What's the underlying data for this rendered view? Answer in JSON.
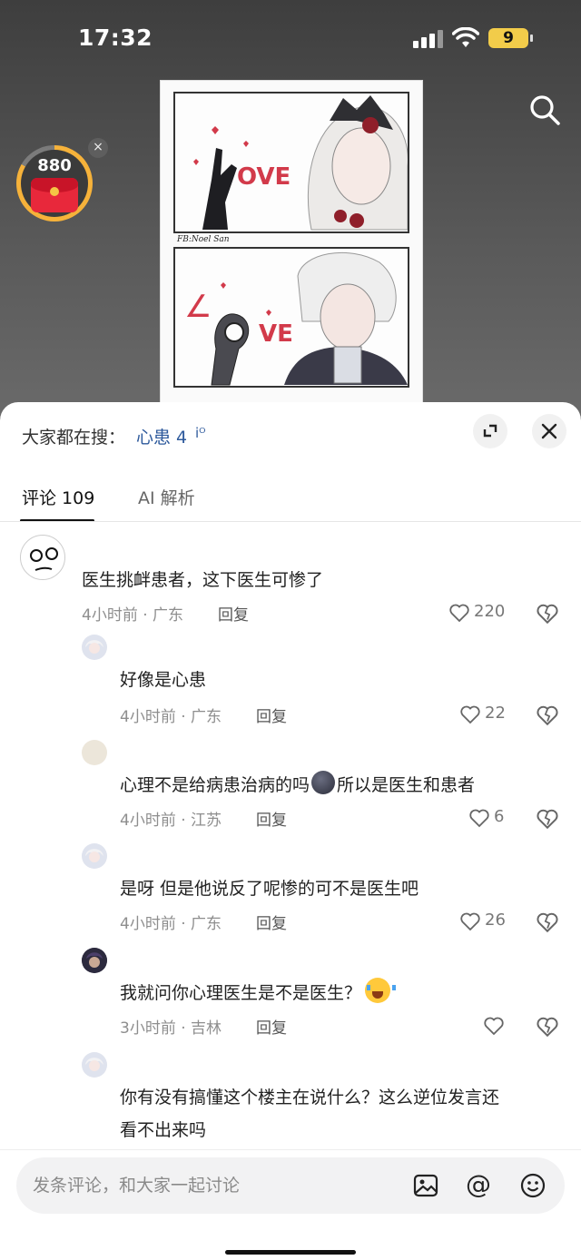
{
  "status_bar": {
    "time": "17:32",
    "battery": "9",
    "icons": [
      "signal-icon",
      "wifi-icon",
      "battery-icon"
    ]
  },
  "reward": {
    "count": "880",
    "icon": "red-envelope-icon",
    "close": "×"
  },
  "video": {
    "artwork_credit": "FB:Noel San",
    "colors": {
      "text_on_dark": "#ffffff",
      "reward_ring": "#f6b23a"
    }
  },
  "sheet": {
    "trending": {
      "label": "大家都在搜：",
      "query": "心患 4",
      "query_icon": "iᴼ"
    },
    "tabs": [
      {
        "label": "评论 109",
        "active": true
      },
      {
        "label": "AI 解析",
        "active": false
      }
    ],
    "colors": {
      "link": "#2e5a9c",
      "meta": "#8e8e8e",
      "text": "#222222"
    }
  },
  "comments": [
    {
      "text": "医生挑衅患者，这下医生可惨了",
      "meta": "4小时前 · 广东",
      "reply": "回复",
      "likes": "220",
      "avatar": "sketch-face-avatar"
    },
    {
      "text": "好像是心患",
      "meta": "4小时前 · 广东",
      "reply": "回复",
      "likes": "22",
      "avatar": "anime-avatar"
    },
    {
      "text_before": "心理不是给病患治病的吗",
      "text_after": "所以是医生和患者",
      "emoji": "dark-face-emoji",
      "meta": "4小时前 · 江苏",
      "reply": "回复",
      "likes": "6",
      "avatar": "beige-avatar"
    },
    {
      "text": "是呀 但是他说反了呢惨的可不是医生吧",
      "meta": "4小时前 · 广东",
      "reply": "回复",
      "likes": "26",
      "avatar": "anime-avatar"
    },
    {
      "text": "我就问你心理医生是不是医生？",
      "emoji": "crying-laugh-emoji",
      "meta": "3小时前 · 吉林",
      "reply": "回复",
      "likes": "",
      "avatar": "dark-anime-avatar"
    },
    {
      "text_line1": "你有没有搞懂这个楼主在说什么？这么逆位发言还",
      "text_line2": "看不出来吗",
      "avatar": "anime-avatar"
    }
  ],
  "input": {
    "placeholder": "发条评论，和大家一起讨论",
    "icons": [
      "image-icon",
      "mention-icon",
      "emoji-icon"
    ],
    "mention_symbol": "@"
  }
}
